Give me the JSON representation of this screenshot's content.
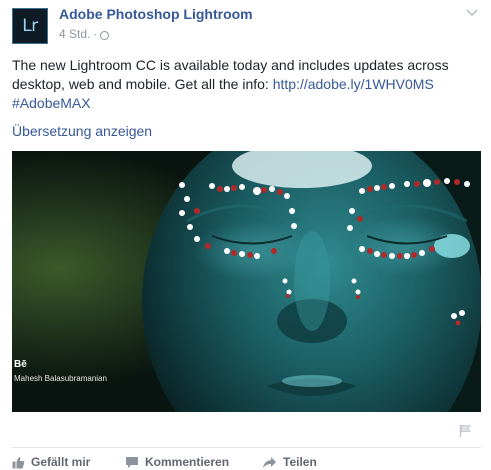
{
  "post": {
    "logo_text": "Lr",
    "page_name": "Adobe Photoshop Lightroom",
    "timestamp": "4 Std.",
    "separator": "·",
    "privacy_icon": "globe-icon",
    "text": "The new Lightroom CC is available today and includes updates across desktop, web and mobile. Get all the info:",
    "link": "http://adobe.ly/1WHV0MS",
    "hashtag": "#AdobeMAX",
    "translate_label": "Übersetzung anzeigen"
  },
  "image": {
    "watermark_logo": "Bē",
    "credit": "Mahesh Balasubramanian"
  },
  "actions": {
    "like_label": "Gefällt mir",
    "comment_label": "Kommentieren",
    "share_label": "Teilen"
  },
  "colors": {
    "link": "#365899",
    "text": "#1d2129",
    "muted": "#90949c",
    "action": "#616770",
    "photo_teal": "#1c6e74"
  }
}
